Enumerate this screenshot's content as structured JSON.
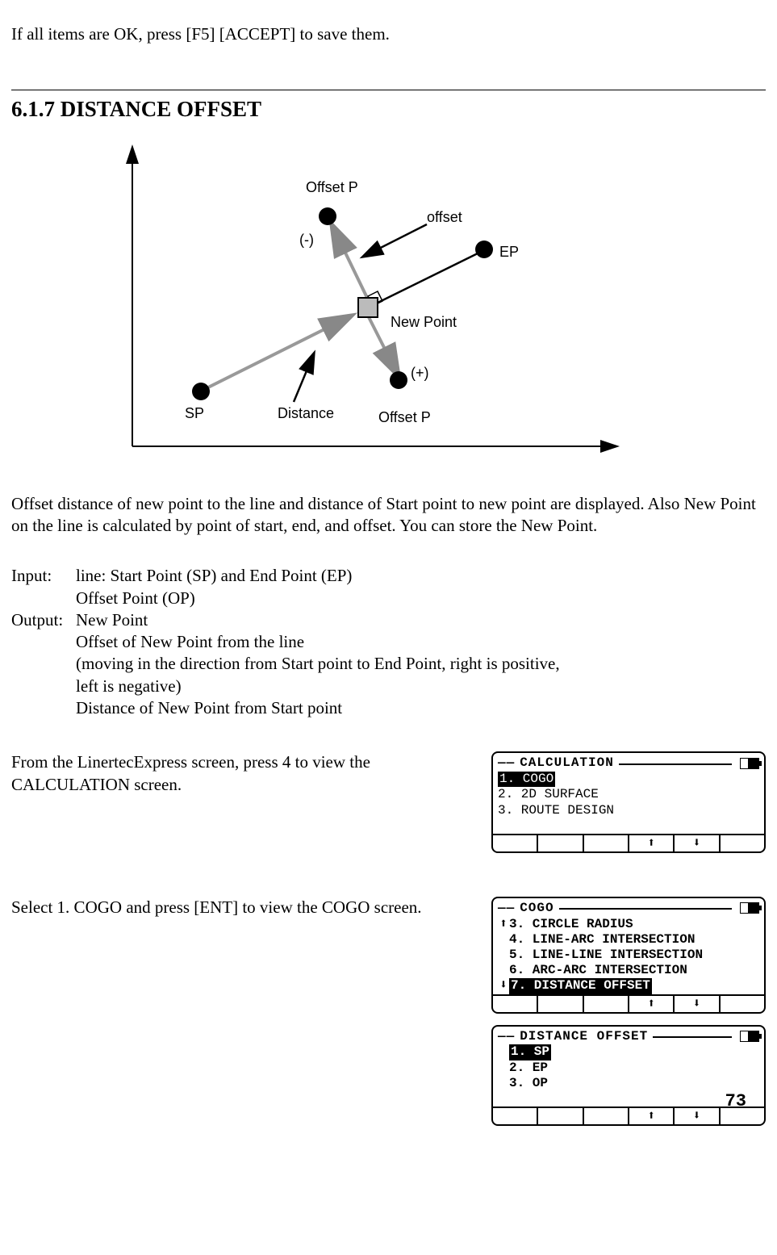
{
  "intro": "If all items are OK, press [F5] [ACCEPT] to save them.",
  "section_heading": "6.1.7 DISTANCE OFFSET",
  "diagram": {
    "offset_p_top": "Offset P",
    "offset_label": "offset",
    "minus": "(-)",
    "ep": "EP",
    "new_point": "New Point",
    "plus": "(+)",
    "sp": "SP",
    "distance": "Distance",
    "offset_p_bottom": "Offset P"
  },
  "description": "Offset distance of new point to the line and distance of Start point to new point are displayed. Also New Point on the line is calculated by point of start, end, and offset. You can store the New Point.",
  "io": {
    "input_label": "Input:",
    "input_1": "line: Start Point (SP) and End Point (EP)",
    "input_2": "Offset Point (OP)",
    "output_label": "Output:",
    "output_1": "New Point",
    "output_2": "Offset of New Point from the line",
    "output_3": " (moving in the direction from Start point to End Point, right is positive,",
    "output_4": "left is negative)",
    "output_5": "Distance of New Point from Start point"
  },
  "step1_text": "From the LinertecExpress screen, press 4 to view the CALCULATION screen.",
  "step2_text": "Select 1. COGO and press [ENT] to view the COGO screen.",
  "screen1": {
    "title": "CALCULATION",
    "items": [
      "1. COGO",
      "2. 2D SURFACE",
      "3. ROUTE DESIGN"
    ],
    "selected": 0,
    "softkeys": [
      "",
      "",
      "",
      "⬆",
      "⬇",
      ""
    ]
  },
  "screen2": {
    "title": "COGO",
    "items": [
      "3. CIRCLE RADIUS",
      "4. LINE-ARC INTERSECTION",
      "5. LINE-LINE INTERSECTION",
      "6. ARC-ARC INTERSECTION",
      "7. DISTANCE OFFSET"
    ],
    "selected": 4,
    "softkeys": [
      "",
      "",
      "",
      "⬆",
      "⬇",
      ""
    ]
  },
  "screen3": {
    "title": "DISTANCE OFFSET",
    "items": [
      "1. SP",
      "2. EP",
      "3. OP"
    ],
    "selected": 0,
    "softkeys": [
      "",
      "",
      "",
      "⬆",
      "⬇",
      ""
    ]
  },
  "page_number": "73"
}
